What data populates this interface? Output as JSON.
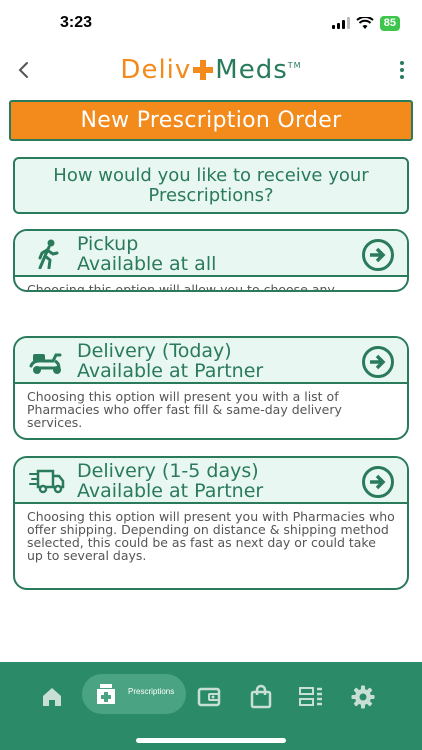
{
  "status_bar": {
    "time": "3:23",
    "battery": "85"
  },
  "header": {
    "logo_left": "Deliv",
    "logo_right": "Meds",
    "trademark": "TM"
  },
  "title": "New Prescription Order",
  "question": "How would you like to receive your Prescriptions?",
  "options": [
    {
      "title_line1": "Pickup",
      "title_line2": "Available at all",
      "description": "Choosing this option will allow you to choose any pharmacy.",
      "icon": "walking-person-icon"
    },
    {
      "title_line1": "Delivery (Today)",
      "title_line2": "Available at Partner",
      "description": "Choosing this option will present you with a list of Pharmacies who offer fast fill & same-day delivery services.",
      "icon": "scooter-icon"
    },
    {
      "title_line1": "Delivery (1-5 days)",
      "title_line2": "Available at Partner",
      "description": "Choosing this option will present you with Pharmacies who offer shipping. Depending on distance & shipping method selected, this could be as fast as next day or could take up to several days.",
      "icon": "delivery-truck-icon"
    }
  ],
  "bottom_nav": {
    "active_label": "Prescriptions",
    "items": [
      "home-icon",
      "prescriptions-icon",
      "wallet-icon",
      "shopping-bag-icon",
      "list-icon",
      "gear-icon"
    ]
  },
  "colors": {
    "brand_green": "#2a7a5c",
    "brand_orange": "#f28a1c",
    "light_green": "#e8f7f1",
    "nav_green": "#2b8a67"
  }
}
